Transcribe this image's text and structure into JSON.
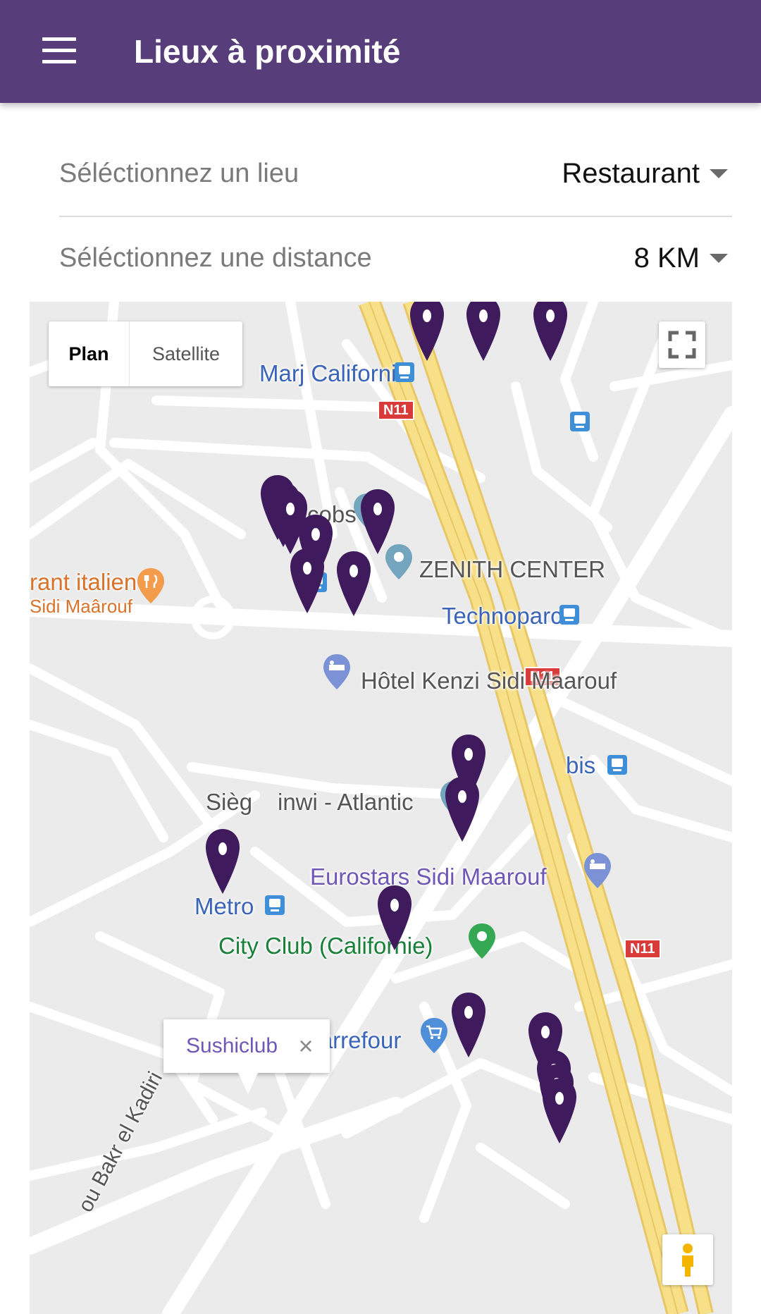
{
  "appbar": {
    "title": "Lieux à proximité"
  },
  "filters": {
    "place": {
      "label": "Séléctionnez un lieu",
      "value": "Restaurant"
    },
    "distance": {
      "label": "Séléctionnez une distance",
      "value": "8 KM"
    }
  },
  "map": {
    "type_control": {
      "plan": "Plan",
      "satellite": "Satellite",
      "selected": "Plan"
    },
    "labels": {
      "marj": "Marj Californi",
      "jacobs": "cobs",
      "zenith": "ZENITH CENTER",
      "italien_1": "rant italien",
      "italien_2": "Sidi Maârouf",
      "technoparc": "Technoparc",
      "kenzi": "Hôtel Kenzi Sidi Maarouf",
      "ibis": "bis",
      "inwi_left": "Sièg",
      "inwi_right": "inwi - Atlantic",
      "metro": "Metro",
      "eurostars": "Eurostars Sidi Maarouf",
      "cityclub": "City Club (Californie)",
      "carrefour": "Carrefour",
      "road": "ou Bakr el Kadiri"
    },
    "road_shields": [
      "N11",
      "N11",
      "N11"
    ],
    "info_window": {
      "title": "Sushiclub"
    },
    "marker_color": "#3f1a5c",
    "colors": {
      "appbar": "#573d7a",
      "highway": "#f8e089",
      "map_bg": "#ebebeb"
    }
  }
}
